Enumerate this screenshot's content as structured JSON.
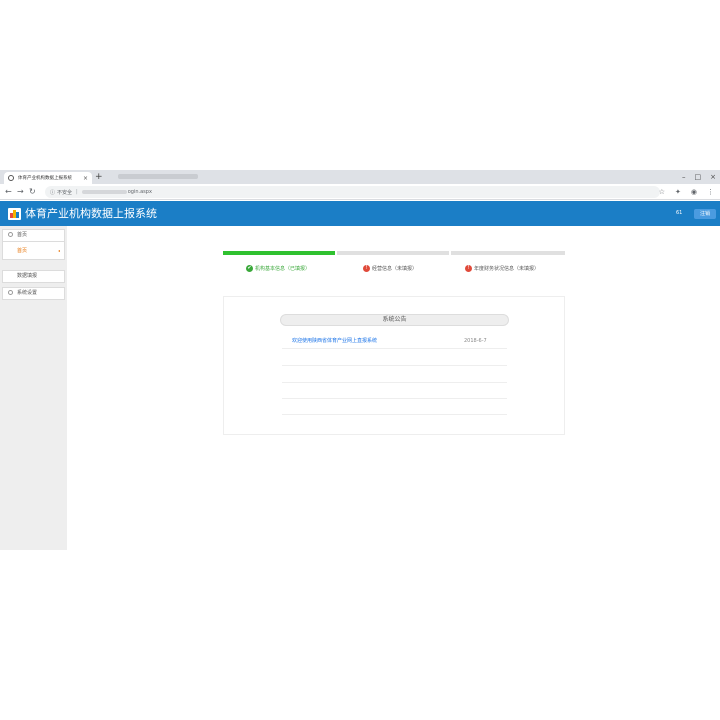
{
  "browser": {
    "tab_title": "体育产业机构数据上报系统",
    "tab_close": "×",
    "new_tab": "+",
    "address_security": "不安全",
    "address_url": "ogin.aspx",
    "window_controls": [
      "–",
      "□",
      "×"
    ]
  },
  "header": {
    "title": "体育产业机构数据上报系统",
    "user_count": "61",
    "logout_label": "注销",
    "brand_color": "#1b7ec6"
  },
  "sidebar": {
    "items": [
      {
        "label": "首页",
        "icon": "circle-icon"
      },
      {
        "label": "数据填报",
        "icon": "circle-icon"
      },
      {
        "label": "系统设置",
        "icon": "circle-icon"
      }
    ],
    "sub_item": {
      "label": "首页",
      "arrow": "◂"
    }
  },
  "progress": {
    "completed_color": "#2fc12f",
    "pending_color": "#e0e0e0",
    "steps": [
      {
        "label": "机构基本信息（已填报）",
        "status": "done",
        "icon": "✔"
      },
      {
        "label": "经营信息（未填报）",
        "status": "pending",
        "icon": "!"
      },
      {
        "label": "年度财务状况信息（未填报）",
        "status": "pending",
        "icon": "!"
      }
    ]
  },
  "notices": {
    "title": "系统公告",
    "items": [
      {
        "text": "欢迎使用陕西省体育产业网上直报系统",
        "date": "2018-6-7"
      }
    ]
  }
}
